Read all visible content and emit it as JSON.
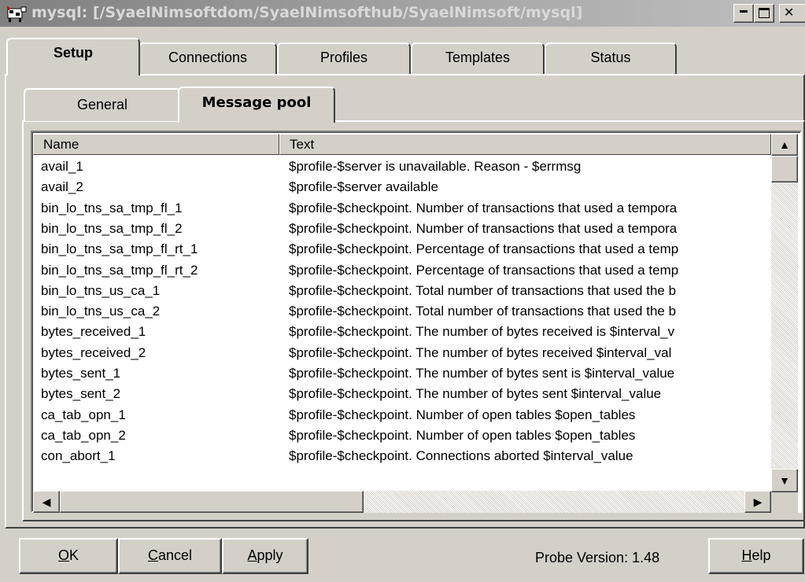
{
  "window": {
    "title": "mysql: [/SyaelNimsoftdom/SyaelNimsofthub/SyaelNimsoft/mysql]"
  },
  "tabs": [
    "Setup",
    "Connections",
    "Profiles",
    "Templates",
    "Status"
  ],
  "subtabs": [
    "General",
    "Message pool"
  ],
  "list": {
    "columns": [
      "Name",
      "Text"
    ],
    "rows": [
      [
        "avail_1",
        "$profile-$server is unavailable. Reason - $errmsg"
      ],
      [
        "avail_2",
        "$profile-$server available"
      ],
      [
        "bin_lo_tns_sa_tmp_fl_1",
        "$profile-$checkpoint. Number of transactions that used a tempora"
      ],
      [
        "bin_lo_tns_sa_tmp_fl_2",
        "$profile-$checkpoint. Number of transactions that used a tempora"
      ],
      [
        "bin_lo_tns_sa_tmp_fl_rt_1",
        "$profile-$checkpoint. Percentage of transactions that used a temp"
      ],
      [
        "bin_lo_tns_sa_tmp_fl_rt_2",
        "$profile-$checkpoint. Percentage of transactions that used a temp"
      ],
      [
        "bin_lo_tns_us_ca_1",
        "$profile-$checkpoint. Total number of transactions that used the b"
      ],
      [
        "bin_lo_tns_us_ca_2",
        "$profile-$checkpoint. Total number of transactions that used the b"
      ],
      [
        "bytes_received_1",
        "$profile-$checkpoint. The number of bytes received is $interval_v"
      ],
      [
        "bytes_received_2",
        "$profile-$checkpoint. The number of bytes received $interval_val"
      ],
      [
        "bytes_sent_1",
        "$profile-$checkpoint. The number of bytes sent is $interval_value"
      ],
      [
        "bytes_sent_2",
        "$profile-$checkpoint. The number of bytes sent $interval_value"
      ],
      [
        "ca_tab_opn_1",
        "$profile-$checkpoint. Number of open tables $open_tables"
      ],
      [
        "ca_tab_opn_2",
        "$profile-$checkpoint. Number of open tables $open_tables"
      ],
      [
        "con_abort_1",
        "$profile-$checkpoint. Connections aborted $interval_value"
      ]
    ]
  },
  "buttons": {
    "ok_u": "O",
    "ok_rest": "K",
    "cancel_u": "C",
    "cancel_rest": "ancel",
    "apply_u": "A",
    "apply_rest": "pply",
    "help_u": "H",
    "help_rest": "elp"
  },
  "probe_version": "Probe Version: 1.48",
  "icons": {
    "app": "nimsoft-cow-icon",
    "scroll_up": "▲",
    "scroll_down": "▼",
    "scroll_left": "◀",
    "scroll_right": "▶"
  }
}
